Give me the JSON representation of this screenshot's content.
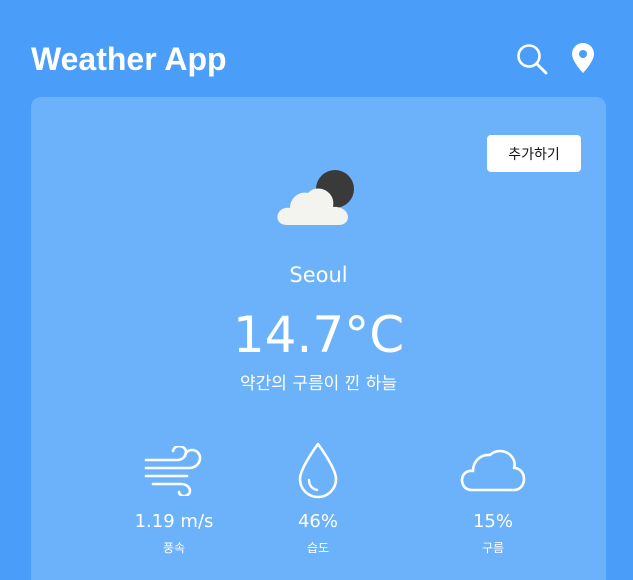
{
  "header": {
    "title": "Weather App",
    "icons": [
      "search-icon",
      "location-pin-icon"
    ]
  },
  "card": {
    "add_button_label": "추가하기",
    "weather_icon": "partly-cloudy-night-icon",
    "city": "Seoul",
    "temperature": "14.7°C",
    "description": "약간의 구름이 낀 하늘",
    "stats": [
      {
        "icon": "wind-icon",
        "value": "1.19 m/s",
        "label": "풍속"
      },
      {
        "icon": "droplet-icon",
        "value": "46%",
        "label": "습도"
      },
      {
        "icon": "cloud-icon",
        "value": "15%",
        "label": "구름"
      }
    ]
  },
  "colors": {
    "background": "#4a9df9",
    "card": "#6cb2fb",
    "text": "#ffffff",
    "button_bg": "#ffffff",
    "button_text": "#111111"
  }
}
